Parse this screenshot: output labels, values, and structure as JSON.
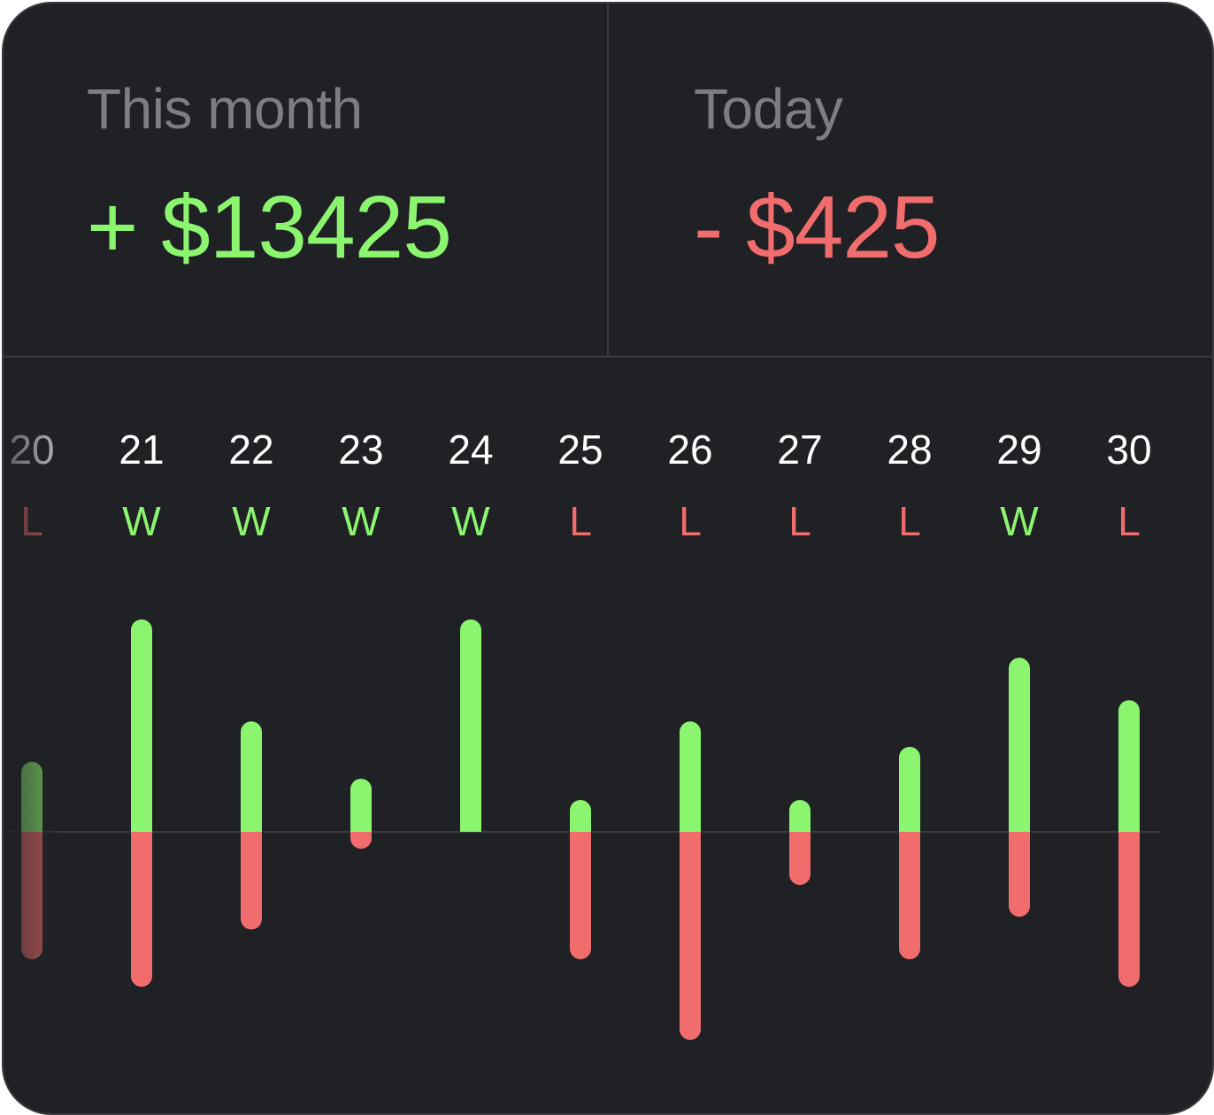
{
  "stats": {
    "month": {
      "label": "This month",
      "value": "+ $13425",
      "color": "#8cf56f"
    },
    "today": {
      "label": "Today",
      "value": "- $425",
      "color": "#f16c6c"
    }
  },
  "colors": {
    "win": "#8cf56f",
    "loss": "#f16c6c",
    "background": "#202125",
    "divider": "#3a3b3f",
    "muted_text": "#7d7e82"
  },
  "chart_data": {
    "type": "bar",
    "categories": [
      "20",
      "21",
      "22",
      "23",
      "24",
      "25",
      "26",
      "27",
      "28",
      "29",
      "30"
    ],
    "results": [
      "L",
      "W",
      "W",
      "W",
      "W",
      "L",
      "L",
      "L",
      "L",
      "W",
      "L"
    ],
    "series": [
      {
        "values": [
          3.3,
          10.0,
          5.2,
          2.5,
          10.0,
          1.5,
          5.2,
          1.5,
          4.0,
          8.2,
          6.2
        ]
      },
      {
        "values": [
          -6.0,
          -7.3,
          -4.6,
          -0.8,
          0,
          -6.0,
          -9.8,
          -2.5,
          -6.0,
          -4.0,
          -7.3
        ]
      }
    ],
    "grid": false
  }
}
